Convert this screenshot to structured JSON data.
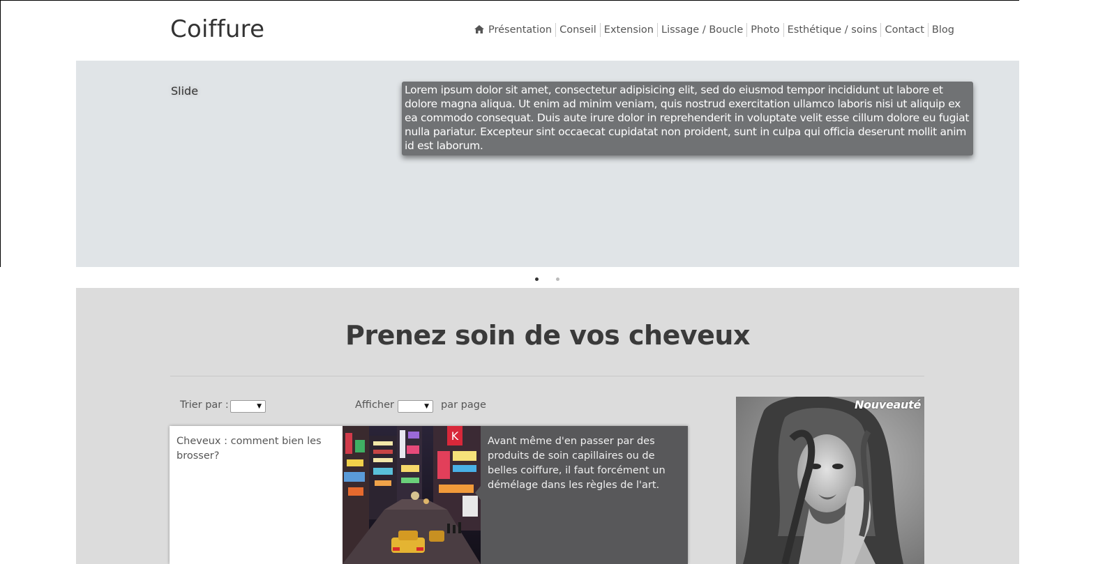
{
  "header": {
    "logo": "Coiffure",
    "nav": [
      {
        "label": "Présentation",
        "icon": "home-icon"
      },
      {
        "label": "Conseil"
      },
      {
        "label": "Extension"
      },
      {
        "label": "Lissage / Boucle"
      },
      {
        "label": "Photo"
      },
      {
        "label": "Esthétique / soins"
      },
      {
        "label": "Contact"
      },
      {
        "label": "Blog"
      }
    ]
  },
  "slider": {
    "label": "Slide",
    "caption": "Lorem ipsum dolor sit amet, consectetur adipisicing elit, sed do eiusmod tempor incididunt ut labore et dolore magna aliqua. Ut enim ad minim veniam, quis nostrud exercitation ullamco laboris nisi ut aliquip ex ea commodo consequat. Duis aute irure dolor in reprehenderit in voluptate velit esse cillum dolore eu fugiat nulla pariatur. Excepteur sint occaecat cupidatat non proident, sunt in culpa qui officia deserunt mollit anim id est laborum.",
    "slide_count": 2,
    "active_slide": 1
  },
  "main": {
    "title": "Prenez soin de vos cheveux",
    "sort_label": "Trier par :",
    "sort_value": "",
    "show_label": "Afficher",
    "show_value": "",
    "per_page_label": "par page",
    "article": {
      "title": "Cheveux : comment bien les brosser?",
      "description": "Avant même d'en passer par des produits de soin capillaires ou de belles coiffure, il faut forcément un démélage dans les règles de l'art."
    },
    "promo": {
      "badge": "Nouveauté"
    }
  },
  "colors": {
    "slider_bg": "#e0e4e7",
    "content_bg": "#dcdcdc",
    "caption_bg": "#707274",
    "card_desc_bg": "#58585a"
  }
}
